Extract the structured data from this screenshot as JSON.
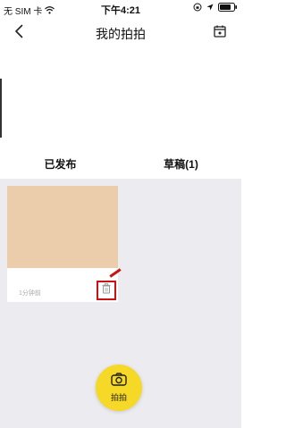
{
  "status_bar": {
    "carrier": "无 SIM 卡",
    "time": "下午4:21",
    "wifi_icon": "wifi-icon",
    "lock_icon": "orientation-lock-icon",
    "location_icon": "location-arrow-icon",
    "battery_icon": "battery-icon"
  },
  "header": {
    "title": "我的拍拍",
    "back_icon": "chevron-left-icon",
    "corner_icon": "calendar-icon"
  },
  "tabs": [
    {
      "label": "已发布"
    },
    {
      "label": "草稿(1)"
    }
  ],
  "drafts": [
    {
      "time": "1分钟前",
      "thumbnail_color": "#eccdab",
      "delete_icon": "trash-icon"
    }
  ],
  "capture": {
    "label": "拍拍",
    "icon": "camera-icon",
    "color": "#f6d826"
  },
  "accent_color": "#cc1111"
}
